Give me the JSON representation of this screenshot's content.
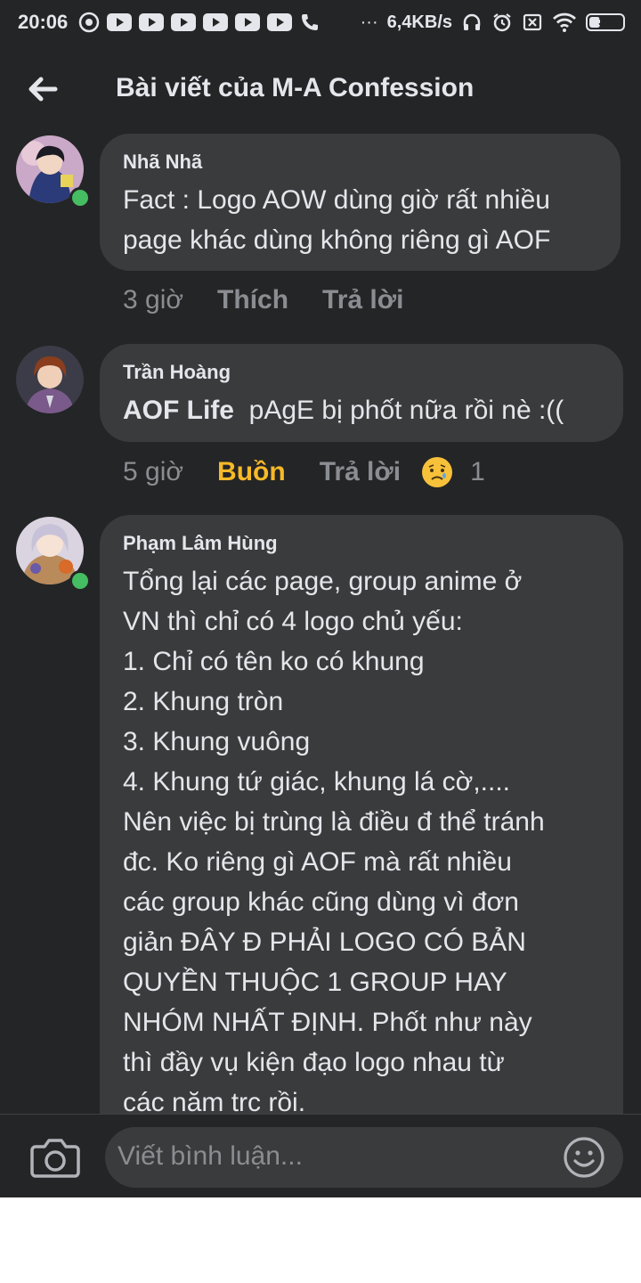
{
  "status_bar": {
    "time": "20:06",
    "network_speed": "6,4KB/s",
    "battery_level": "32",
    "battery_fraction": 0.32,
    "overflow": "···"
  },
  "header": {
    "title": "Bài viết của M-A Confession",
    "back_icon": "arrow-left-icon"
  },
  "comments": [
    {
      "author": "Nhã Nhã",
      "text": "Fact : Logo AOW dùng giờ rất nhiều\npage khác dùng không riêng gì AOF",
      "online": true,
      "time": "3 giờ",
      "like_label": "Thích",
      "reply_label": "Trả lời"
    },
    {
      "author": "Trần Hoàng",
      "mention": "AOF Life",
      "text": "pAgE bị phốt nữa rồi nè :((",
      "online": false,
      "time": "5 giờ",
      "reaction_label": "Buồn",
      "reaction_color": "#f7b928",
      "reply_label": "Trả lời",
      "reaction_icon": "sad-emoji-icon",
      "reaction_count": "1"
    },
    {
      "author": "Phạm Lâm Hùng",
      "text": "Tổng lại các page, group anime ở\nVN thì chỉ có 4 logo chủ yếu:\n1. Chỉ có tên ko có khung\n2. Khung tròn\n3. Khung vuông\n4. Khung tứ giác, khung lá cờ,....\nNên việc bị trùng là điều đ thể tránh\nđc. Ko riêng gì AOF mà rất nhiều\ncác group khác cũng dùng vì đơn\ngiản ĐÂY Đ PHẢI LOGO CÓ BẢN\nQUYỀN THUỘC 1 GROUP HAY\nNHÓM NHẤT ĐỊNH. Phốt như này\nthì đầy vụ kiện đạo logo nhau từ\ncác năm trc rồi.",
      "online": true
    }
  ],
  "composer": {
    "placeholder": "Viết bình luận...",
    "camera_icon": "camera-icon",
    "emoji_icon": "smiley-icon"
  },
  "colors": {
    "background": "#242526",
    "bubble": "#3a3b3c",
    "online": "#45bd62",
    "muted_text": "#8a8d91"
  }
}
